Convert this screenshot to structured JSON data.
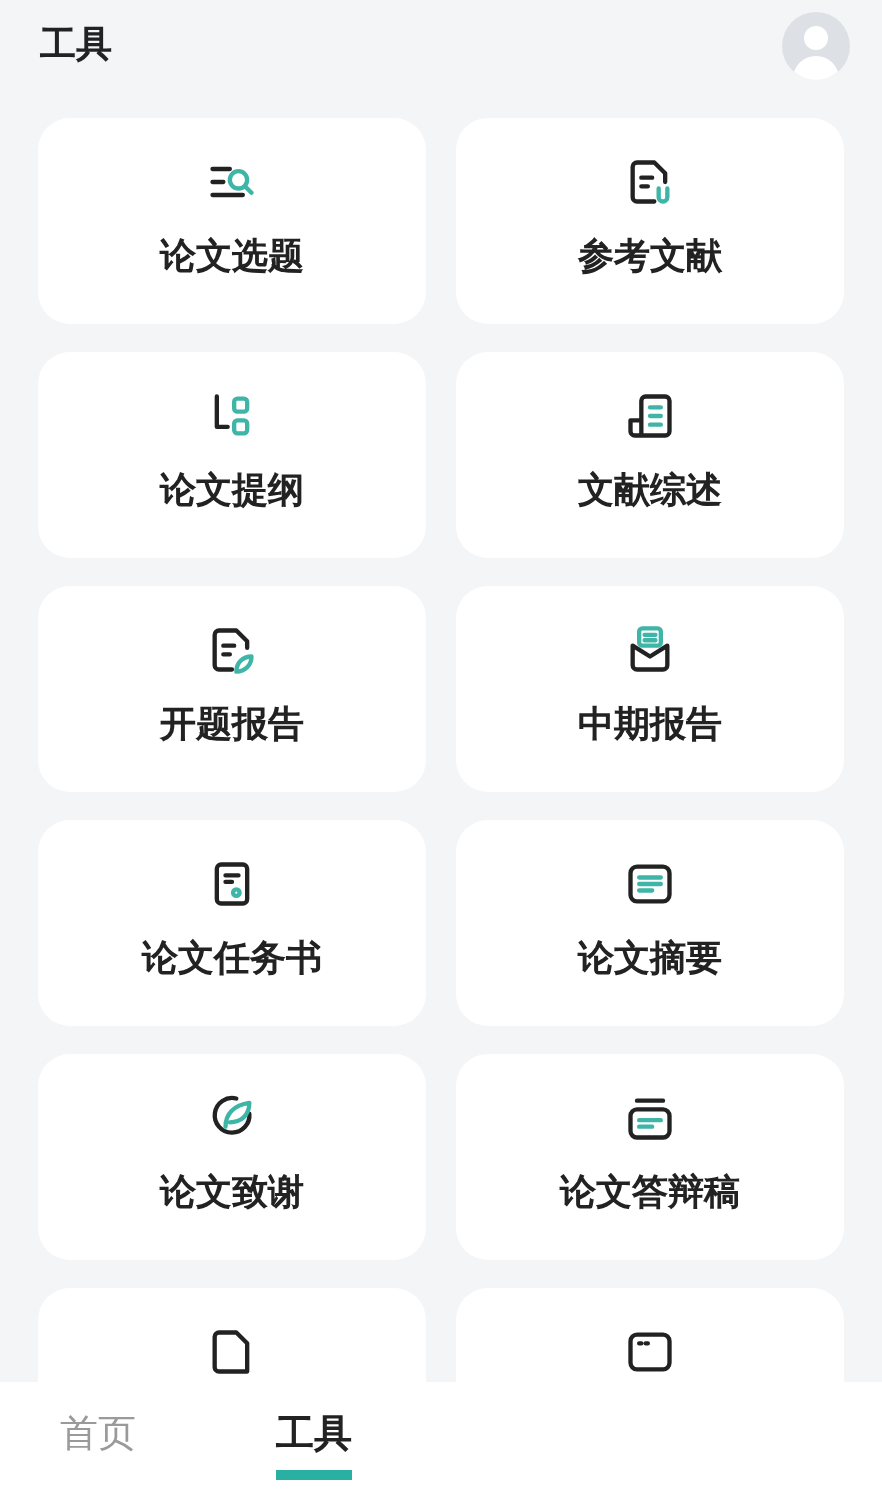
{
  "header": {
    "title": "工具"
  },
  "tools": [
    {
      "kind": "tool",
      "label": "论文选题"
    },
    {
      "kind": "tool",
      "label": "参考文献"
    },
    {
      "kind": "tool",
      "label": "论文提纲"
    },
    {
      "kind": "tool",
      "label": "文献综述"
    },
    {
      "kind": "tool",
      "label": "开题报告"
    },
    {
      "kind": "tool",
      "label": "中期报告"
    },
    {
      "kind": "tool",
      "label": "论文任务书"
    },
    {
      "kind": "tool",
      "label": "论文摘要"
    },
    {
      "kind": "tool",
      "label": "论文致谢"
    },
    {
      "kind": "tool",
      "label": "论文答辩稿"
    },
    {
      "kind": "partial"
    },
    {
      "kind": "partial"
    }
  ],
  "tabs": [
    {
      "label": "首页",
      "selected": false
    },
    {
      "label": "工具",
      "selected": true
    }
  ]
}
